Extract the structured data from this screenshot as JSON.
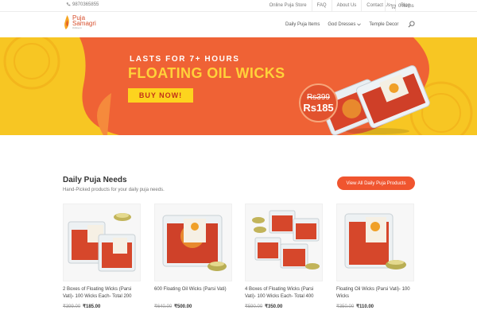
{
  "topbar": {
    "phone": "9870365855",
    "links": [
      "Online Puja Store",
      "FAQ",
      "About Us",
      "Contact Us",
      "Blog"
    ],
    "cart_label": "0 Items"
  },
  "brand": {
    "line1": "Puja",
    "line2": "Samagri",
    "line3": "Online.in"
  },
  "nav": {
    "items": [
      "Daily Puja Items",
      "God Dresses",
      "Temple Decor"
    ]
  },
  "hero": {
    "eyebrow": "LASTS FOR 7+ HOURS",
    "title": "FLOATING OIL WICKS",
    "button": "BUY NOW!",
    "old_price": "Rs399",
    "new_price": "Rs185"
  },
  "section": {
    "title": "Daily Puja Needs",
    "subtitle": "Hand-Picked products for your daily puja needs.",
    "view_all": "View All Daily Puja Products"
  },
  "products": [
    {
      "name": "2 Boxes of Floating Wicks (Parsi Vati)- 100 Wicks Each- Total 200",
      "was": "₹399.00",
      "now": "₹185.00"
    },
    {
      "name": "600 Floating Oil Wicks (Parsi Vati)",
      "was": "₹640.00",
      "now": "₹500.00"
    },
    {
      "name": "4 Boxes of Floating Wicks (Parsi Vati)- 100 Wicks Each- Total 400",
      "was": "₹590.00",
      "now": "₹350.00"
    },
    {
      "name": "Floating Oil Wicks (Parsi Vati)- 100 Wicks",
      "was": "₹350.00",
      "now": "₹110.00"
    }
  ],
  "colors": {
    "accent": "#f0552f",
    "hero_bg": "#f7c623",
    "hero_band": "#ef6235",
    "button_bg": "#fdd41e"
  },
  "icons": [
    "phone-icon",
    "cart-icon",
    "flame-logo-icon",
    "chevron-down-icon",
    "search-icon"
  ]
}
